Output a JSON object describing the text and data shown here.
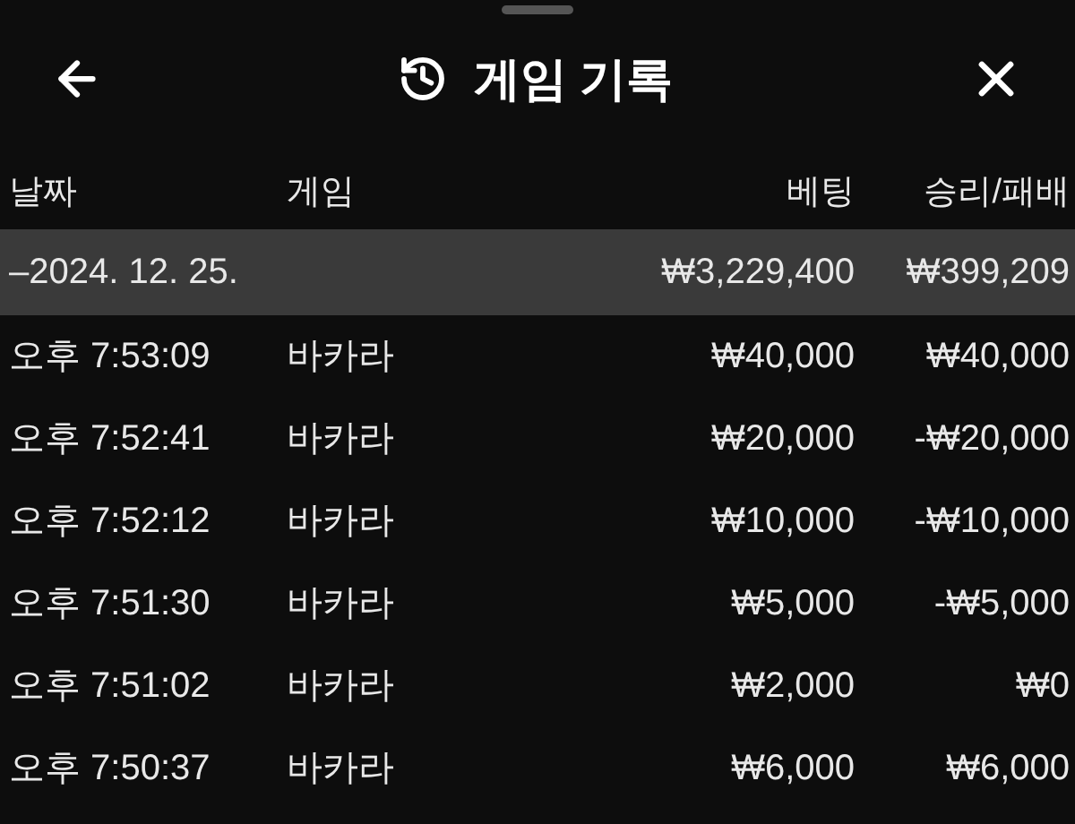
{
  "header": {
    "title": "게임 기록"
  },
  "columns": [
    "날짜",
    "게임",
    "베팅",
    "승리/패배"
  ],
  "groups": [
    {
      "date": "–2024. 12. 25.",
      "bet": "₩3,229,400",
      "result": "₩399,209",
      "rows": [
        {
          "time": "오후 7:53:09",
          "game": "바카라",
          "bet": "₩40,000",
          "result": "₩40,000"
        },
        {
          "time": "오후 7:52:41",
          "game": "바카라",
          "bet": "₩20,000",
          "result": "-₩20,000"
        },
        {
          "time": "오후 7:52:12",
          "game": "바카라",
          "bet": "₩10,000",
          "result": "-₩10,000"
        },
        {
          "time": "오후 7:51:30",
          "game": "바카라",
          "bet": "₩5,000",
          "result": "-₩5,000"
        },
        {
          "time": "오후 7:51:02",
          "game": "바카라",
          "bet": "₩2,000",
          "result": "₩0"
        },
        {
          "time": "오후 7:50:37",
          "game": "바카라",
          "bet": "₩6,000",
          "result": "₩6,000"
        }
      ]
    }
  ]
}
